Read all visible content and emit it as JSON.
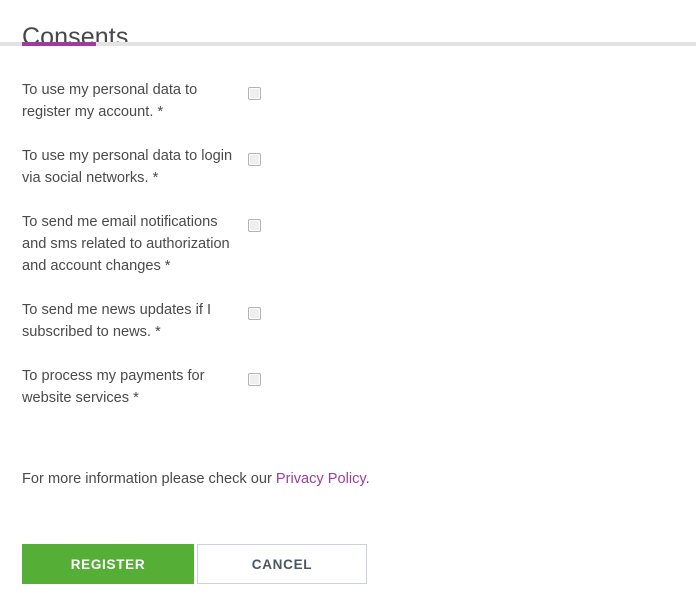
{
  "page": {
    "title": "Consents"
  },
  "theme": {
    "accent_purple": "#9c3d9e",
    "divider_gray": "#e3e3e3",
    "register_green": "#55af37",
    "link_purple": "#a23ba0",
    "text_gray": "#4a4a4a",
    "cancel_border": "#ccd3da"
  },
  "consents": [
    {
      "label": "To use my personal data to register my account. *",
      "checked": false,
      "checkbox_name": "consent-checkbox-register-account"
    },
    {
      "label": "To use my personal data to login via social networks. *",
      "checked": false,
      "checkbox_name": "consent-checkbox-social-login"
    },
    {
      "label": "To send me email notifications and sms related to authorization and account changes *",
      "checked": false,
      "checkbox_name": "consent-checkbox-notifications"
    },
    {
      "label": "To send me news updates if I subscribed to news. *",
      "checked": false,
      "checkbox_name": "consent-checkbox-news-updates"
    },
    {
      "label": "To process my payments for website services *",
      "checked": false,
      "checkbox_name": "consent-checkbox-payments"
    }
  ],
  "info": {
    "prefix": "For more information please check our ",
    "link_text": "Privacy Policy",
    "suffix": "."
  },
  "actions": {
    "register_label": "REGISTER",
    "cancel_label": "CANCEL"
  }
}
